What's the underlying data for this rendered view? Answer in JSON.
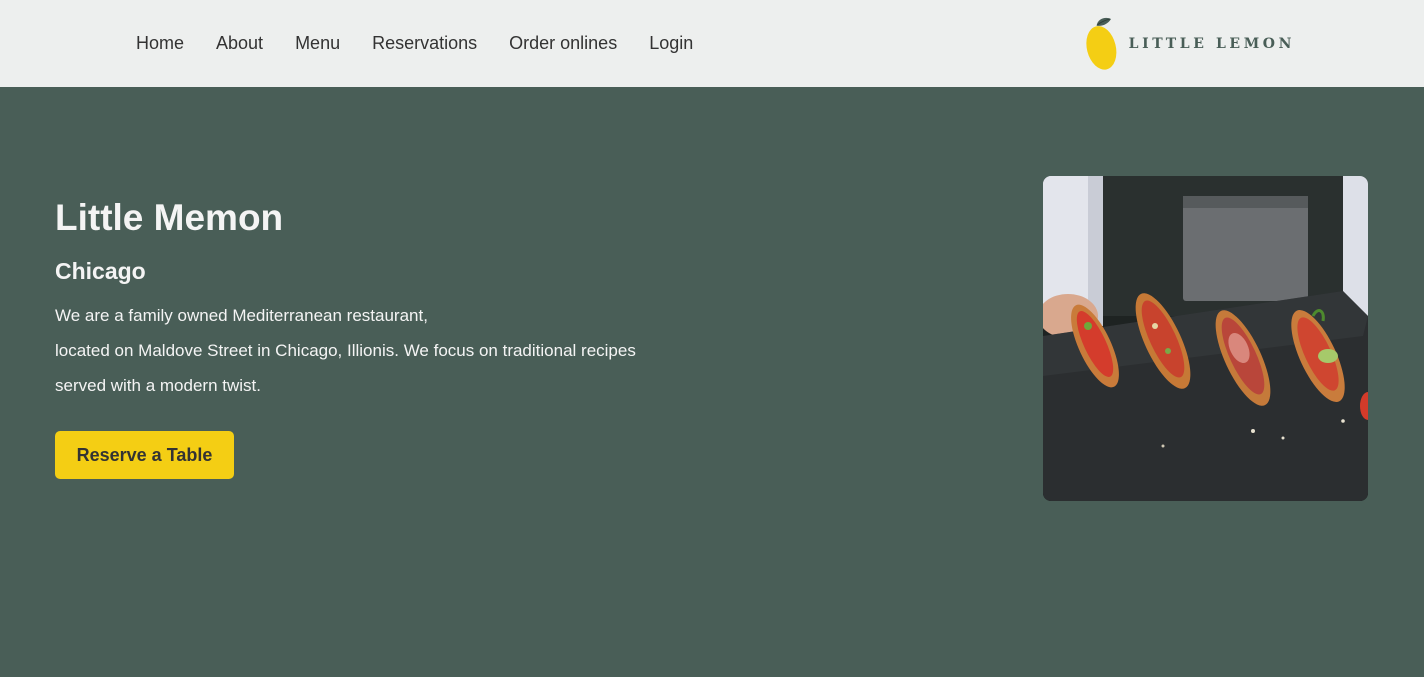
{
  "nav": {
    "items": [
      {
        "label": "Home"
      },
      {
        "label": "About"
      },
      {
        "label": "Menu"
      },
      {
        "label": "Reservations"
      },
      {
        "label": "Order onlines"
      },
      {
        "label": "Login"
      }
    ]
  },
  "logo": {
    "text": "LITTLE LEMON",
    "icon": "lemon-logo-icon",
    "color": "#495e57"
  },
  "hero": {
    "title": "Little Memon",
    "subtitle": "Chicago",
    "description": [
      "We are a family owned Mediterranean restaurant,",
      "located on Maldove Street in Chicago, Illionis. We focus on traditional recipes",
      "served with a modern twist."
    ],
    "cta_label": "Reserve a Table",
    "image": "food-photo"
  },
  "colors": {
    "header_bg": "#edefee",
    "hero_bg": "#495e57",
    "accent_yellow": "#f4ce14",
    "text_light": "#f4f4f4",
    "text_dark": "#333333"
  }
}
